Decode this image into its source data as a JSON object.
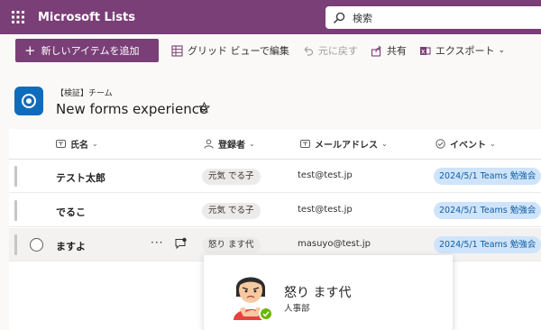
{
  "app": {
    "title": "Microsoft Lists"
  },
  "search": {
    "placeholder": "検索"
  },
  "commands": {
    "new_item": "新しいアイテムを追加",
    "grid_edit": "グリッド ビューで編集",
    "undo": "元に戻す",
    "share": "共有",
    "export": "エクスポート"
  },
  "list": {
    "subtitle": "【検証】チーム",
    "title": "New forms experience"
  },
  "columns": {
    "name": "氏名",
    "registrant": "登録者",
    "email": "メールアドレス",
    "event": "イベント"
  },
  "rows": [
    {
      "name": "テスト太郎",
      "registrant": "元気 でる子",
      "email": "test@test.jp",
      "event": "2024/5/1 Teams 勉強会"
    },
    {
      "name": "でるこ",
      "registrant": "元気 でる子",
      "email": "test@test.jp",
      "event": "2024/5/1 Teams 勉強会"
    },
    {
      "name": "ますよ",
      "registrant": "怒り ます代",
      "email": "masuyo@test.jp",
      "event": "2024/5/1 Teams 勉強会"
    }
  ],
  "persona": {
    "name": "怒り ます代",
    "department": "人事部",
    "presence": "available"
  },
  "colors": {
    "brand": "#7a3f77",
    "event_pill_bg": "#cfe4fa",
    "event_pill_text": "#115ea3",
    "presence_available": "#6bb700"
  },
  "icons": [
    "waffle-icon",
    "search-icon",
    "plus-icon",
    "grid-edit-icon",
    "undo-icon",
    "share-icon",
    "export-icon",
    "list-app-icon",
    "star-icon",
    "text-column-icon",
    "person-column-icon",
    "check-circle-column-icon",
    "more-icon",
    "comment-icon",
    "presence-check-icon"
  ]
}
